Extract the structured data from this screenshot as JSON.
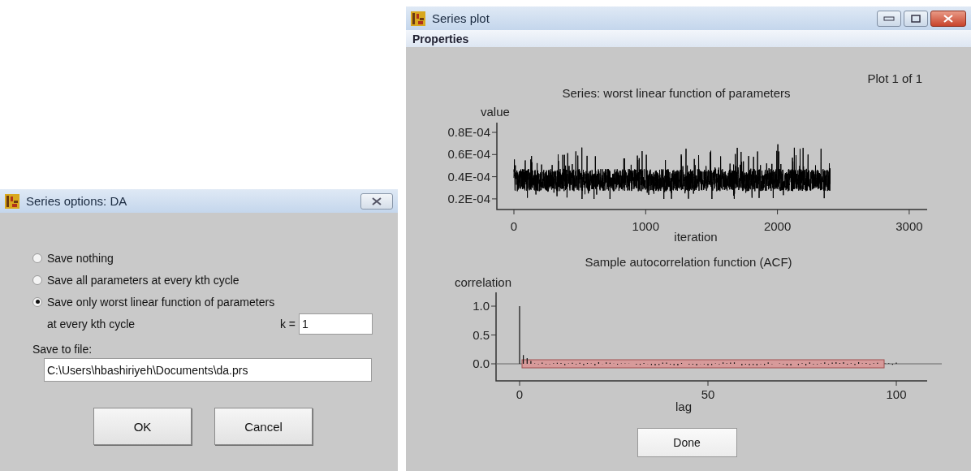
{
  "options_dialog": {
    "title": "Series options: DA",
    "options": [
      {
        "label": "Save nothing",
        "selected": false
      },
      {
        "label": "Save all parameters at every kth cycle",
        "selected": false
      },
      {
        "label": "Save only worst linear function of parameters",
        "sublabel": "at every kth cycle",
        "selected": true
      }
    ],
    "k_label": "k =",
    "k_value": "1",
    "file_label": "Save to file:",
    "file_value": "C:\\Users\\hbashiriyeh\\Documents\\da.prs",
    "buttons": [
      "OK",
      "Cancel"
    ]
  },
  "plot_window": {
    "title": "Series plot",
    "menu": [
      "Properties"
    ],
    "plot_counter": "Plot 1 of 1",
    "trace_plot": {
      "title": "Series: worst linear function of parameters",
      "ylabel": "value",
      "xlabel": "iteration",
      "yticks": [
        "0.8E-04",
        "0.6E-04",
        "0.4E-04",
        "0.2E-04"
      ],
      "xticks": [
        "0",
        "1000",
        "2000",
        "3000"
      ]
    },
    "acf_plot": {
      "title": "Sample autocorrelation function (ACF)",
      "ylabel": "correlation",
      "xlabel": "lag",
      "yticks": [
        "1.0",
        "0.5",
        "0.0"
      ],
      "xticks": [
        "0",
        "50",
        "100"
      ]
    },
    "done_button": "Done"
  }
}
